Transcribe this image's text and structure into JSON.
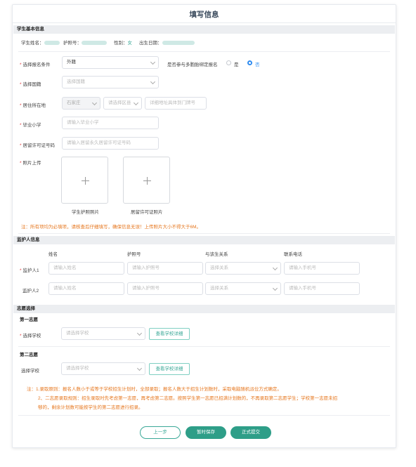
{
  "page_title": "填写信息",
  "sections": {
    "basic": "学生基本信息",
    "guardian": "监护人信息",
    "choice": "志愿选择"
  },
  "student_info": {
    "name_label": "学生姓名：",
    "passport_label": "护照号：",
    "gender_label": "性别：",
    "gender_value": "女",
    "dob_label": "出生日期："
  },
  "form": {
    "condition_label": "选择报名条件",
    "condition_value": "外籍",
    "priority_label": "是否参与多胞胎绑定报名",
    "priority_yes": "是",
    "priority_no": "否",
    "nationality_label": "选择国籍",
    "nationality_placeholder": "选择国籍",
    "address_label": "居住所在地",
    "address_city": "石家庄",
    "address_district_placeholder": "请选择区县",
    "address_detail_placeholder": "详细地址具体到门牌号",
    "school_label": "毕业小学",
    "school_placeholder": "请输入毕业小学",
    "permit_label": "居留许可证号码",
    "permit_placeholder": "请输入居留永久居留许可证号码",
    "photo_label": "照片上传",
    "photo1_caption": "学生护照照片",
    "photo2_caption": "居留许可证照片",
    "note": "注：所有项均为必填项，请核查后仔细填写，确保信息无误！上传照片大小不得大于6M。"
  },
  "guardian": {
    "columns": [
      "姓名",
      "护照号",
      "与该生关系",
      "联系电话"
    ],
    "rows": [
      {
        "label": "监护人1",
        "name_placeholder": "请输入姓名",
        "passport_placeholder": "请输入护照号",
        "relation_placeholder": "选择关系",
        "phone_placeholder": "请输入手机号"
      },
      {
        "label": "监护人2",
        "name_placeholder": "请输入姓名",
        "passport_placeholder": "请输入护照号",
        "relation_placeholder": "选择关系",
        "phone_placeholder": "请输入手机号"
      }
    ]
  },
  "choice": {
    "first_title": "第一志愿",
    "second_title": "第二志愿",
    "school_label": "选择学校",
    "school_placeholder": "请选择学校",
    "detail_button": "查看学校详细",
    "note_line1": "注：1.录取原则：报名人数小于或等于学校招生计划时，全部录取；报名人数大于招生计划数时，采取电脑随机派位方式确定。",
    "note_line2": "2、二志愿录取规则：招生录取时先考虑第一志愿，再考虑第二志愿。按照学生第一志愿已招满计划数的，不再录取第二志愿学生；学校第一志愿未招",
    "note_line3": "够的，剩余计划数可能按学生的第二志愿进行招录。"
  },
  "buttons": {
    "prev": "上一步",
    "save": "暂时保存",
    "submit": "正式提交"
  },
  "colors": {
    "accent": "#2e9e88",
    "required": "#e4393c",
    "note": "#e6771f",
    "radio_selected": "#2f8cf0"
  }
}
